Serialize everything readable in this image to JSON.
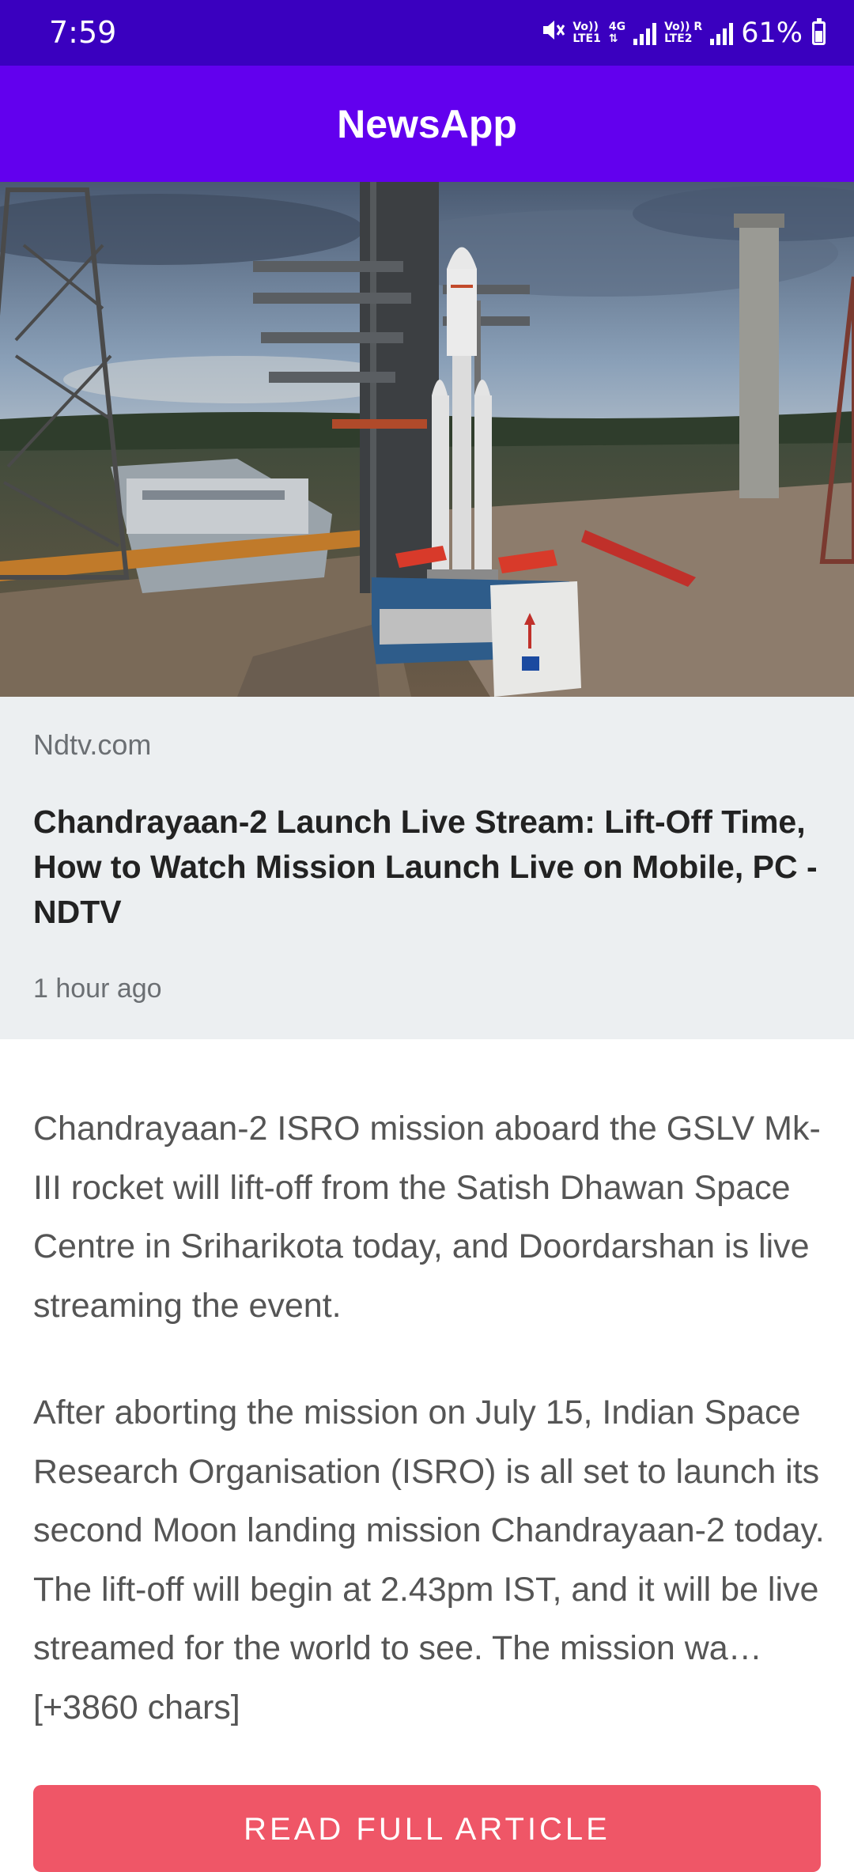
{
  "status_bar": {
    "time": "7:59",
    "sim1_label": "Vo))",
    "sim1_sub": "LTE1",
    "network_type": "4G",
    "sim2_label": "Vo))",
    "sim2_sub": "LTE2",
    "roaming": "R",
    "battery_percent": "61%",
    "icons": [
      "mute-icon",
      "signal-icon",
      "battery-charging-icon"
    ]
  },
  "app_bar": {
    "title": "NewsApp"
  },
  "article": {
    "image_alt": "rocket-on-launch-pad",
    "source": "Ndtv.com",
    "title": "Chandrayaan-2 Launch Live Stream: Lift-Off Time, How to Watch Mission Launch Live on Mobile, PC - NDTV",
    "published": "1 hour ago",
    "description": "Chandrayaan-2 ISRO mission aboard the GSLV Mk-III rocket will lift-off from the Satish Dhawan Space Centre in Sriharikota today, and Doordarshan is live streaming the event.",
    "content": "After aborting the mission on July 15, Indian Space Research Organisation (ISRO) is all set to launch its second Moon landing mission Chandrayaan-2 today. The lift-off will begin at 2.43pm IST, and it will be live streamed for the world to see. The mission wa… [+3860 chars]",
    "read_button": "READ FULL ARTICLE"
  },
  "colors": {
    "status_bar": "#3a00bf",
    "app_bar": "#6200ee",
    "meta_panel": "#eceff1",
    "button": "#ef5667"
  }
}
